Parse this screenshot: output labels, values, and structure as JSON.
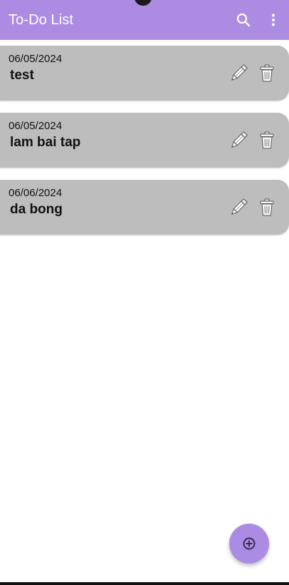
{
  "app_bar": {
    "title": "To-Do List",
    "background": "#ac8be3",
    "actions": [
      {
        "icon": "search-icon"
      },
      {
        "icon": "more-vert-icon"
      }
    ]
  },
  "tasks": [
    {
      "date": "06/05/2024",
      "title": "test",
      "edit_icon": "pencil-icon",
      "delete_icon": "trash-icon"
    },
    {
      "date": "06/05/2024",
      "title": "lam bai tap",
      "edit_icon": "pencil-icon",
      "delete_icon": "trash-icon"
    },
    {
      "date": "06/06/2024",
      "title": "da bong",
      "edit_icon": "pencil-icon",
      "delete_icon": "trash-icon"
    }
  ],
  "card_color": "#bdbdbd",
  "fab": {
    "icon": "add-circle-icon",
    "color": "#ac8be3"
  }
}
